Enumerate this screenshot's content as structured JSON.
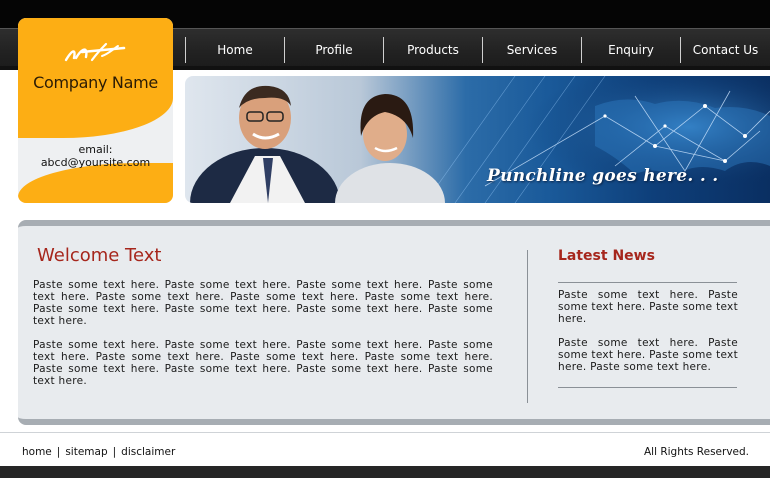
{
  "nav": {
    "items": [
      {
        "label": "Home"
      },
      {
        "label": "Profile"
      },
      {
        "label": "Products"
      },
      {
        "label": "Services"
      },
      {
        "label": "Enquiry"
      },
      {
        "label": "Contact Us"
      }
    ]
  },
  "logo": {
    "company_name": "Company Name",
    "email_label": "email:",
    "email_value": "abcd@yoursite.com",
    "icon": "logo-mark-icon"
  },
  "banner": {
    "punchline": "Punchline goes here. . ."
  },
  "welcome": {
    "title": "Welcome Text",
    "paragraphs": [
      "Paste some text here. Paste some text here. Paste some text here. Paste some text here. Paste some text here. Paste some text here. Paste some text here. Paste some text here. Paste some text here. Paste some text here. Paste some text here.",
      "Paste some text here. Paste some text here. Paste some text here. Paste some text here. Paste some text here. Paste some text here. Paste some text here. Paste some text here. Paste some text here. Paste some text here. Paste some text here."
    ]
  },
  "news": {
    "title": "Latest News",
    "items": [
      "Paste some text here. Paste some text here. Paste some text here.",
      "Paste some text here. Paste some text here. Paste some text here. Paste some text here."
    ]
  },
  "footer": {
    "links": [
      {
        "label": "home"
      },
      {
        "label": "sitemap"
      },
      {
        "label": "disclaimer"
      }
    ],
    "separator": "|",
    "copyright": "All Rights Reserved."
  },
  "colors": {
    "accent_orange": "#fdae14",
    "heading_red": "#a6261c",
    "nav_bg": "#262626"
  }
}
